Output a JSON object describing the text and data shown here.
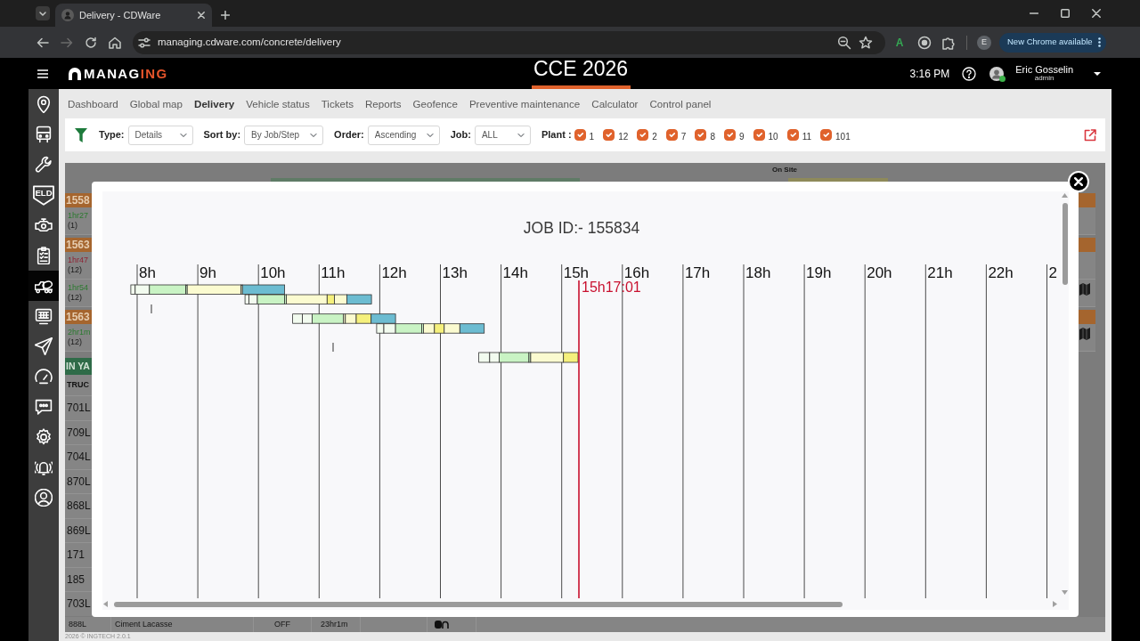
{
  "browser": {
    "tab_title": "Delivery - CDWare",
    "url": "managing.cdware.com/concrete/delivery",
    "extension_letter": "A",
    "profile_initial": "E",
    "update_button": "New Chrome available"
  },
  "header": {
    "logo": {
      "main": "MANAG",
      "accent": "ING"
    },
    "event_title": "CCE 2026",
    "time": "3:16 PM",
    "user": {
      "name": "Eric Gosselin",
      "role": "admin"
    }
  },
  "sidebar": {
    "items": [
      {
        "kind": "pin",
        "selected": false
      },
      {
        "kind": "bus",
        "selected": false
      },
      {
        "kind": "wrench",
        "selected": false
      },
      {
        "kind": "eld",
        "badge": "ELD",
        "selected": false
      },
      {
        "kind": "engine",
        "selected": false
      },
      {
        "kind": "checklist",
        "selected": false
      },
      {
        "kind": "mixer",
        "selected": true
      },
      {
        "kind": "screen",
        "selected": false
      },
      {
        "kind": "send",
        "selected": false
      },
      {
        "kind": "gauge",
        "selected": false
      },
      {
        "kind": "chat",
        "selected": false
      },
      {
        "kind": "gear",
        "selected": false
      },
      {
        "kind": "alarm",
        "selected": false
      },
      {
        "kind": "user",
        "selected": false
      }
    ]
  },
  "nav": [
    {
      "label": "Dashboard",
      "selected": false
    },
    {
      "label": "Global map",
      "selected": false
    },
    {
      "label": "Delivery",
      "selected": true
    },
    {
      "label": "Vehicle status",
      "selected": false
    },
    {
      "label": "Tickets",
      "selected": false
    },
    {
      "label": "Reports",
      "selected": false
    },
    {
      "label": "Geofence",
      "selected": false
    },
    {
      "label": "Preventive maintenance",
      "selected": false
    },
    {
      "label": "Calculator",
      "selected": false
    },
    {
      "label": "Control panel",
      "selected": false
    }
  ],
  "filters": {
    "selects": [
      {
        "label": "Type:",
        "value": "Details"
      },
      {
        "label": "Sort by:",
        "value": "By Job/Step"
      },
      {
        "label": "Order:",
        "value": "Ascending"
      },
      {
        "label": "Job:",
        "value": "ALL"
      }
    ],
    "plants": {
      "label": "Plant :",
      "options": [
        {
          "label": "1",
          "checked": true
        },
        {
          "label": "12",
          "checked": true
        },
        {
          "label": "2",
          "checked": true
        },
        {
          "label": "7",
          "checked": true
        },
        {
          "label": "8",
          "checked": true
        },
        {
          "label": "9",
          "checked": true
        },
        {
          "label": "10",
          "checked": true
        },
        {
          "label": "11",
          "checked": true
        },
        {
          "label": "101",
          "checked": true
        }
      ]
    }
  },
  "background": {
    "column_header": "On Site",
    "jobs": [
      {
        "kind": "header",
        "text": "1558"
      },
      {
        "kind": "trip",
        "duration": "1hr27",
        "count": "(1)",
        "color": "#2b7a2f",
        "has_map": false
      },
      {
        "kind": "header",
        "text": "1563"
      },
      {
        "kind": "trip",
        "duration": "1hr47",
        "count": "(12)",
        "color": "#8e2233",
        "has_map": false
      },
      {
        "kind": "trip",
        "duration": "1hr54",
        "count": "(12)",
        "color": "#2b7a2f",
        "has_map": true
      },
      {
        "kind": "header",
        "text": "1563"
      },
      {
        "kind": "trip",
        "duration": "2hr1m",
        "count": "(12)",
        "color": "#2b7a2f",
        "has_map": true
      }
    ],
    "yard": {
      "title": "IN YA",
      "column": "TRUC",
      "trucks": [
        "701L",
        "709L",
        "704L",
        "870L",
        "868L",
        "869L",
        "171",
        "185",
        "703L"
      ]
    },
    "last_row": {
      "truck": "888L",
      "client": "Ciment Lacasse",
      "state": "OFF",
      "duration": "23hr1m"
    }
  },
  "modal": {
    "title": "JOB ID:- 155834",
    "hours": [
      "8h",
      "9h",
      "10h",
      "11h",
      "12h",
      "13h",
      "14h",
      "15h",
      "16h",
      "17h",
      "18h",
      "19h",
      "20h",
      "21h",
      "22h",
      "2"
    ],
    "now_label": "15h17:01"
  },
  "footer": "2026 © INGTECH 2.0.1"
}
